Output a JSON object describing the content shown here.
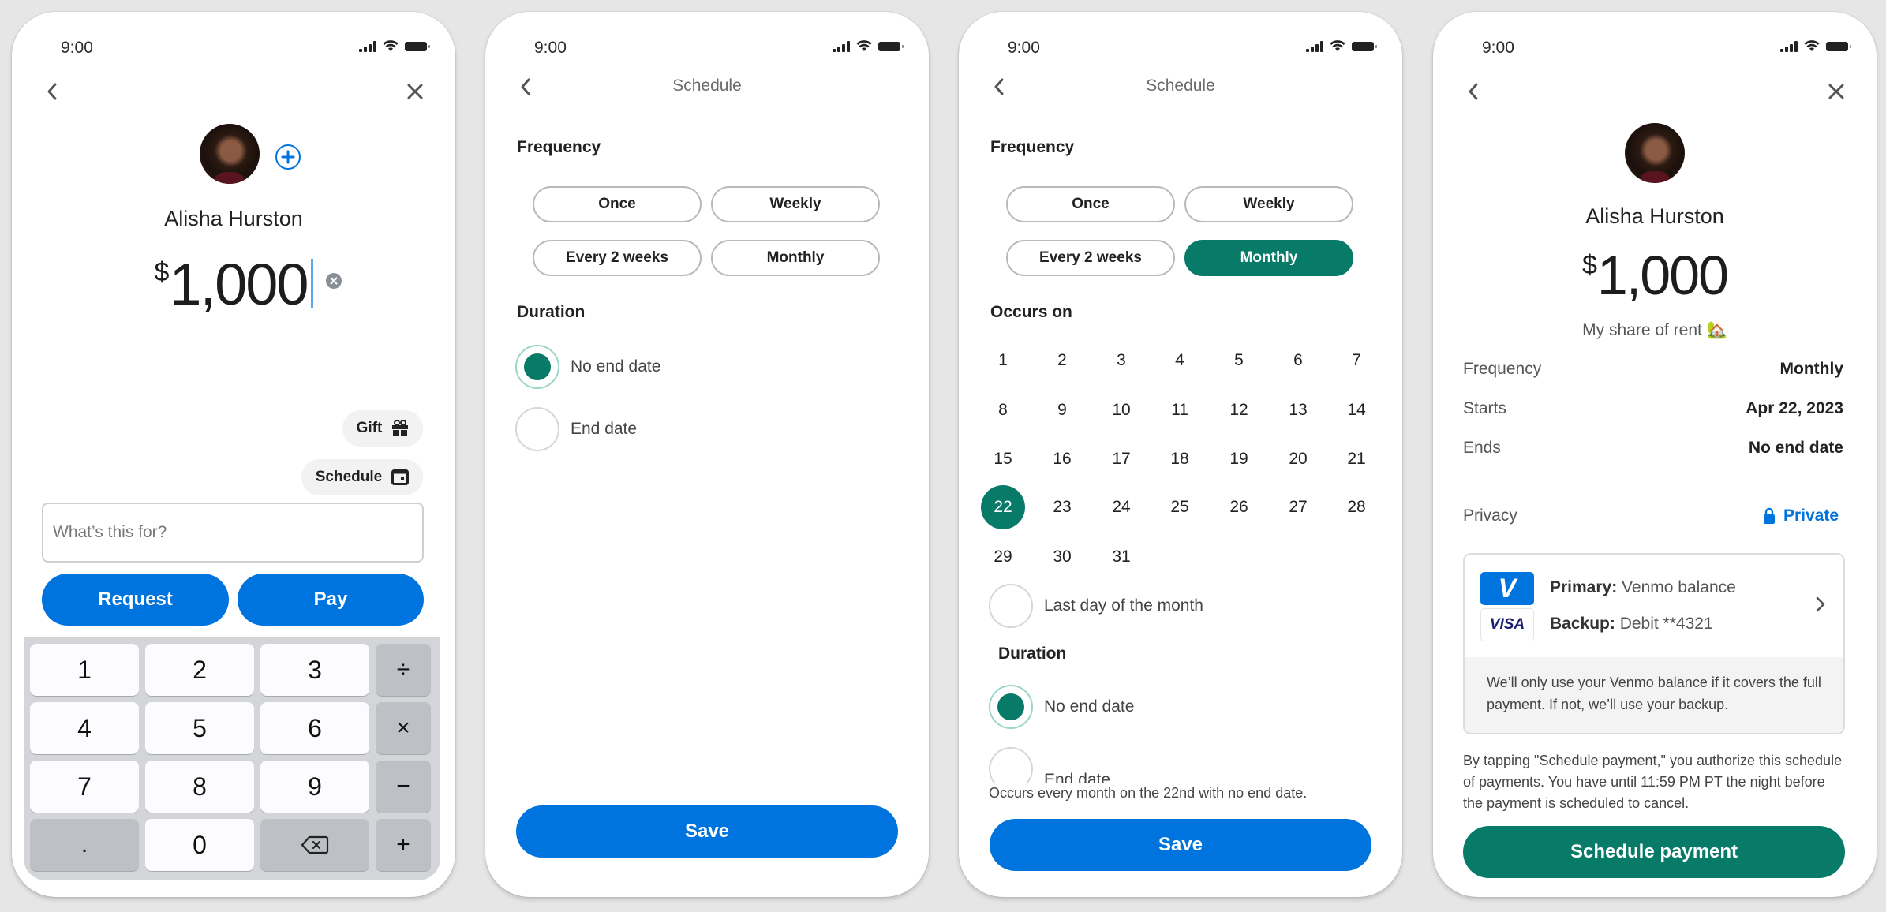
{
  "status_bar": {
    "time": "9:00",
    "icons": [
      "signal-icon",
      "wifi-icon",
      "battery-icon"
    ]
  },
  "colors": {
    "primary_blue": "#0074de",
    "accent_green": "#087a68",
    "background": "#e6e6e6"
  },
  "screen_amount": {
    "recipient_name": "Alisha Hurston",
    "currency_symbol": "$",
    "amount": "1,000",
    "gift_label": "Gift",
    "schedule_label": "Schedule",
    "memo_placeholder": "What’s this for?",
    "request_label": "Request",
    "pay_label": "Pay",
    "keypad": [
      [
        "1",
        "2",
        "3",
        "÷"
      ],
      [
        "4",
        "5",
        "6",
        "×"
      ],
      [
        "7",
        "8",
        "9",
        "−"
      ],
      [
        ".",
        "0",
        "⌫",
        "+"
      ]
    ]
  },
  "screen_schedule": {
    "title": "Schedule",
    "frequency_label": "Frequency",
    "frequency_options": [
      "Once",
      "Weekly",
      "Every 2 weeks",
      "Monthly"
    ],
    "selected_frequency": null,
    "duration_label": "Duration",
    "duration_options": [
      "No end date",
      "End date"
    ],
    "selected_duration": "No end date",
    "save_label": "Save"
  },
  "screen_schedule_monthly": {
    "title": "Schedule",
    "frequency_label": "Frequency",
    "frequency_options": [
      "Once",
      "Weekly",
      "Every 2 weeks",
      "Monthly"
    ],
    "selected_frequency": "Monthly",
    "occurs_on_label": "Occurs on",
    "days": [
      "1",
      "2",
      "3",
      "4",
      "5",
      "6",
      "7",
      "8",
      "9",
      "10",
      "11",
      "12",
      "13",
      "14",
      "15",
      "16",
      "17",
      "18",
      "19",
      "20",
      "21",
      "22",
      "23",
      "24",
      "25",
      "26",
      "27",
      "28",
      "29",
      "30",
      "31"
    ],
    "selected_day": "22",
    "last_day_label": "Last day of the month",
    "duration_label": "Duration",
    "duration_options": [
      "No end date",
      "End date"
    ],
    "selected_duration": "No end date",
    "summary": "Occurs every month on the 22nd with no end date.",
    "save_label": "Save"
  },
  "screen_review": {
    "recipient_name": "Alisha Hurston",
    "currency_symbol": "$",
    "amount": "1,000",
    "note": "My share of rent 🏡",
    "details": [
      {
        "label": "Frequency",
        "value": "Monthly"
      },
      {
        "label": "Starts",
        "value": "Apr 22, 2023"
      },
      {
        "label": "Ends",
        "value": "No end date"
      }
    ],
    "privacy_label": "Privacy",
    "privacy_value": "Private",
    "payment": {
      "venmo_logo": "V",
      "visa_logo": "VISA",
      "primary_label": "Primary:",
      "primary_value": "Venmo balance",
      "backup_label": "Backup:",
      "backup_value": "Debit **4321",
      "note": "We’ll only use your Venmo balance if it covers the full payment. If not, we’ll use your backup."
    },
    "disclaimer": "By tapping \"Schedule payment,\" you authorize this schedule of payments. You have until 11:59 PM PT the night before the payment is scheduled to cancel.",
    "submit_label": "Schedule payment"
  }
}
